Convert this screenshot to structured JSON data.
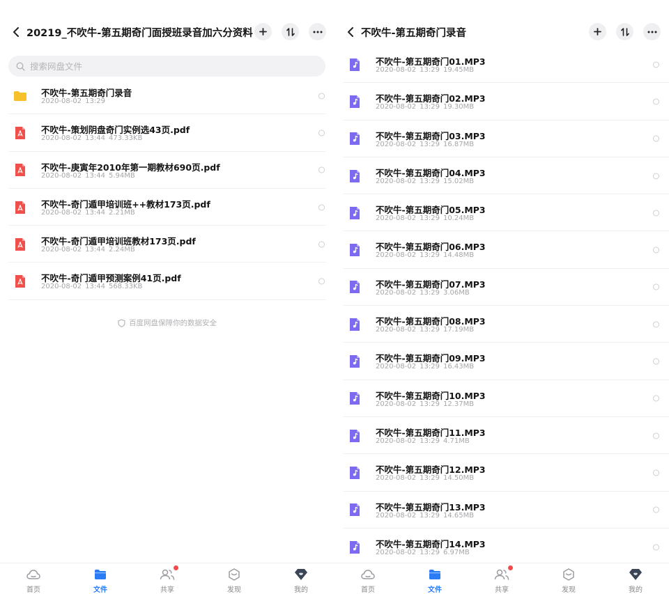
{
  "colors": {
    "accent": "#2a7cf6",
    "folder": "#f6c12a",
    "pdf": "#f0504b",
    "audio": "#7c6bf0",
    "badge": "#f24a4a"
  },
  "left": {
    "title": "20219_不吹牛-第五期奇门面授班录音加六分资料",
    "search_placeholder": "搜索网盘文件",
    "items": [
      {
        "name": "不吹牛-第五期奇门录音",
        "date": "2020-08-02",
        "time": "13:29",
        "size": "",
        "type": "folder"
      },
      {
        "name": "不吹牛-策划阴盘奇门实例选43页.pdf",
        "date": "2020-08-02",
        "time": "13:44",
        "size": "473.33KB",
        "type": "pdf"
      },
      {
        "name": "不吹牛-庚寅年2010年第一期教材690页.pdf",
        "date": "2020-08-02",
        "time": "13:44",
        "size": "5.94MB",
        "type": "pdf"
      },
      {
        "name": "不吹牛-奇门遁甲培训班++教材173页.pdf",
        "date": "2020-08-02",
        "time": "13:44",
        "size": "2.21MB",
        "type": "pdf"
      },
      {
        "name": "不吹牛-奇门遁甲培训班教材173页.pdf",
        "date": "2020-08-02",
        "time": "13:44",
        "size": "2.24MB",
        "type": "pdf"
      },
      {
        "name": "不吹牛-奇门遁甲预测案例41页.pdf",
        "date": "2020-08-02",
        "time": "13:44",
        "size": "568.33KB",
        "type": "pdf"
      }
    ],
    "footer_note": "百度网盘保障你的数据安全"
  },
  "right": {
    "title": "不吹牛-第五期奇门录音",
    "items": [
      {
        "name": "不吹牛-第五期奇门01.MP3",
        "date": "2020-08-02",
        "time": "13:29",
        "size": "19.45MB",
        "type": "audio"
      },
      {
        "name": "不吹牛-第五期奇门02.MP3",
        "date": "2020-08-02",
        "time": "13:29",
        "size": "19.30MB",
        "type": "audio"
      },
      {
        "name": "不吹牛-第五期奇门03.MP3",
        "date": "2020-08-02",
        "time": "13:29",
        "size": "16.87MB",
        "type": "audio"
      },
      {
        "name": "不吹牛-第五期奇门04.MP3",
        "date": "2020-08-02",
        "time": "13:29",
        "size": "15.02MB",
        "type": "audio"
      },
      {
        "name": "不吹牛-第五期奇门05.MP3",
        "date": "2020-08-02",
        "time": "13:29",
        "size": "10.24MB",
        "type": "audio"
      },
      {
        "name": "不吹牛-第五期奇门06.MP3",
        "date": "2020-08-02",
        "time": "13:29",
        "size": "14.48MB",
        "type": "audio"
      },
      {
        "name": "不吹牛-第五期奇门07.MP3",
        "date": "2020-08-02",
        "time": "13:29",
        "size": "3.06MB",
        "type": "audio"
      },
      {
        "name": "不吹牛-第五期奇门08.MP3",
        "date": "2020-08-02",
        "time": "13:29",
        "size": "17.19MB",
        "type": "audio"
      },
      {
        "name": "不吹牛-第五期奇门09.MP3",
        "date": "2020-08-02",
        "time": "13:29",
        "size": "16.43MB",
        "type": "audio"
      },
      {
        "name": "不吹牛-第五期奇门10.MP3",
        "date": "2020-08-02",
        "time": "13:29",
        "size": "12.37MB",
        "type": "audio"
      },
      {
        "name": "不吹牛-第五期奇门11.MP3",
        "date": "2020-08-02",
        "time": "13:29",
        "size": "4.71MB",
        "type": "audio"
      },
      {
        "name": "不吹牛-第五期奇门12.MP3",
        "date": "2020-08-02",
        "time": "13:29",
        "size": "14.50MB",
        "type": "audio"
      },
      {
        "name": "不吹牛-第五期奇门13.MP3",
        "date": "2020-08-02",
        "time": "13:29",
        "size": "14.65MB",
        "type": "audio"
      },
      {
        "name": "不吹牛-第五期奇门14.MP3",
        "date": "2020-08-02",
        "time": "13:29",
        "size": "6.97MB",
        "type": "audio"
      }
    ]
  },
  "tabbar": {
    "items": [
      {
        "label": "首页",
        "icon": "cloud-icon"
      },
      {
        "label": "文件",
        "icon": "folder-icon",
        "active": true
      },
      {
        "label": "共享",
        "icon": "people-icon",
        "badge": true
      },
      {
        "label": "发现",
        "icon": "discover-icon"
      },
      {
        "label": "我的",
        "icon": "profile-icon"
      }
    ]
  }
}
